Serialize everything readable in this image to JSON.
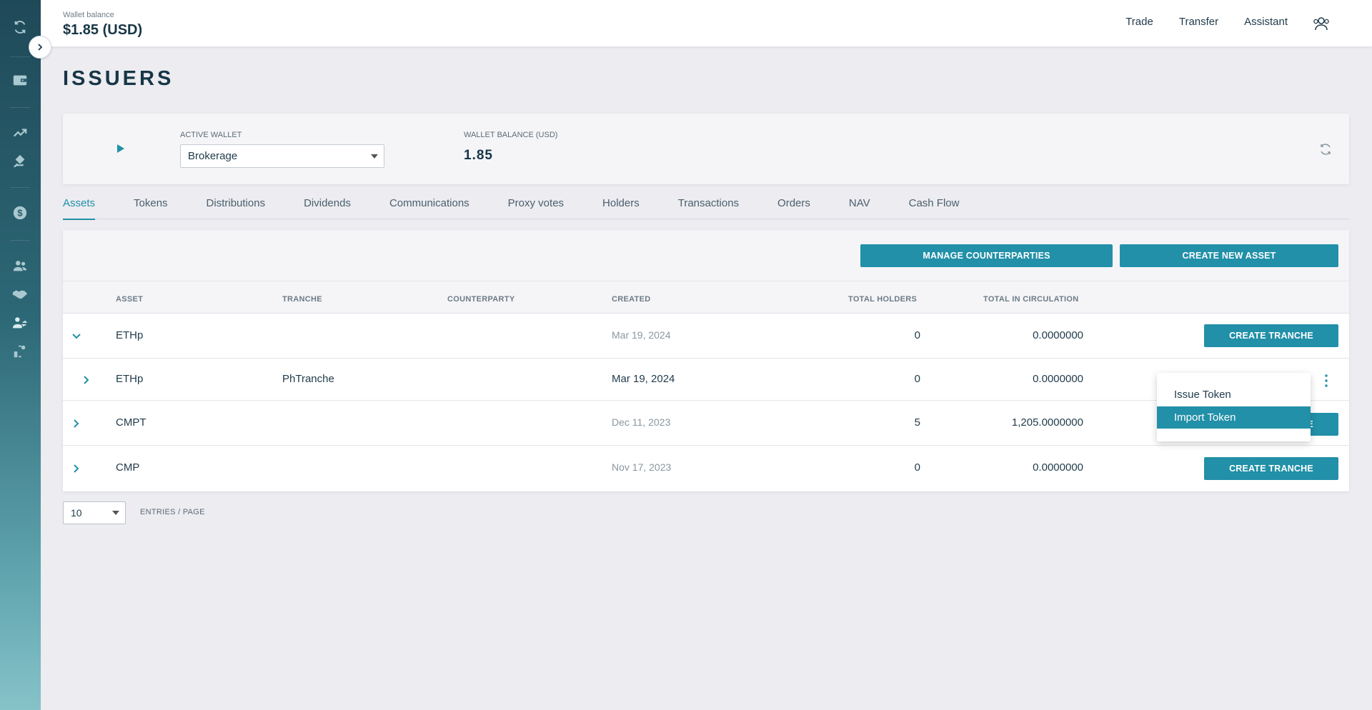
{
  "header": {
    "wallet_balance_label": "Wallet balance",
    "wallet_balance_value": "$1.85 (USD)",
    "nav": [
      "Trade",
      "Transfer",
      "Assistant"
    ]
  },
  "page": {
    "title": "ISSUERS"
  },
  "wallet_card": {
    "active_wallet_label": "ACTIVE WALLET",
    "active_wallet_value": "Brokerage",
    "balance_label": "WALLET BALANCE (USD)",
    "balance_value": "1.85"
  },
  "tabs": [
    "Assets",
    "Tokens",
    "Distributions",
    "Dividends",
    "Communications",
    "Proxy votes",
    "Holders",
    "Transactions",
    "Orders",
    "NAV",
    "Cash Flow"
  ],
  "active_tab": "Assets",
  "actions": {
    "manage_counterparties": "MANAGE COUNTERPARTIES",
    "create_new_asset": "CREATE NEW ASSET"
  },
  "table": {
    "headers": {
      "asset": "ASSET",
      "tranche": "TRANCHE",
      "counterparty": "COUNTERPARTY",
      "created": "CREATED",
      "total_holders": "TOTAL HOLDERS",
      "total_in_circulation": "TOTAL IN CIRCULATION"
    },
    "rows": [
      {
        "asset": "ETHp",
        "tranche": "",
        "counterparty": "",
        "created": "Mar 19, 2024",
        "holders": "0",
        "circulation": "0.0000000",
        "action": "CREATE TRANCHE",
        "expanded": true
      },
      {
        "asset": "ETHp",
        "tranche": "PhTranche",
        "counterparty": "",
        "created": "Mar 19, 2024",
        "holders": "0",
        "circulation": "0.0000000",
        "action": "",
        "child": true
      },
      {
        "asset": "CMPT",
        "tranche": "",
        "counterparty": "",
        "created": "Dec 11, 2023",
        "holders": "5",
        "circulation": "1,205.0000000",
        "action": "CREATE TRANCHE"
      },
      {
        "asset": "CMP",
        "tranche": "",
        "counterparty": "",
        "created": "Nov 17, 2023",
        "holders": "0",
        "circulation": "0.0000000",
        "action": "CREATE TRANCHE"
      }
    ]
  },
  "row_menu": {
    "items": [
      "Issue Token",
      "Import Token"
    ],
    "highlighted": "Import Token"
  },
  "pagination": {
    "page_size": "10",
    "entries_label": "ENTRIES / PAGE"
  },
  "colors": {
    "accent": "#2290a8",
    "sidebar_top": "#1f4958",
    "sidebar_bottom": "#86c3c9",
    "background": "#ececf1"
  }
}
